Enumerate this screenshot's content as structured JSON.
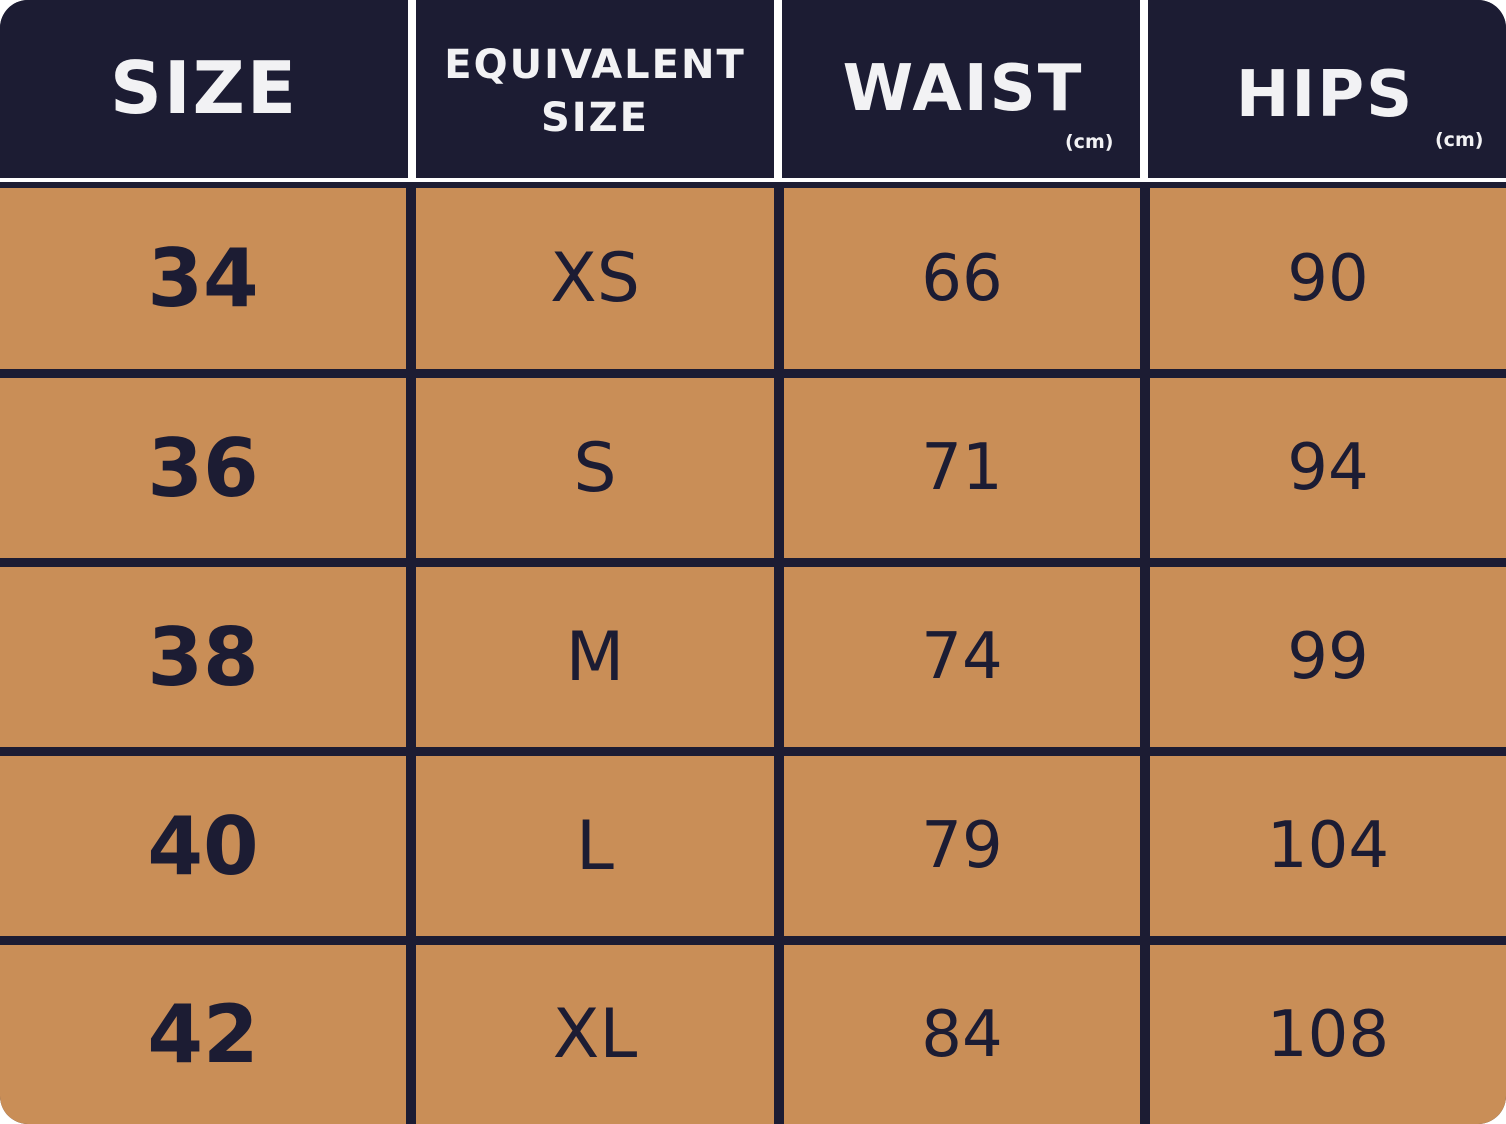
{
  "colors": {
    "header_bg": "#1c1c33",
    "header_text": "#f2f2f4",
    "body_bg": "#c98e57",
    "body_text": "#1c1c33",
    "grid_lines": "#1c1c33"
  },
  "header": {
    "size": "SIZE",
    "equivalent_line1": "EQUIVALENT",
    "equivalent_line2": "SIZE",
    "waist": "WAIST",
    "waist_unit": "(cm)",
    "hips": "HIPS",
    "hips_unit": "(cm)"
  },
  "rows": [
    {
      "size": "34",
      "equivalent": "XS",
      "waist": "66",
      "hips": "90"
    },
    {
      "size": "36",
      "equivalent": "S",
      "waist": "71",
      "hips": "94"
    },
    {
      "size": "38",
      "equivalent": "M",
      "waist": "74",
      "hips": "99"
    },
    {
      "size": "40",
      "equivalent": "L",
      "waist": "79",
      "hips": "104"
    },
    {
      "size": "42",
      "equivalent": "XL",
      "waist": "84",
      "hips": "108"
    }
  ]
}
